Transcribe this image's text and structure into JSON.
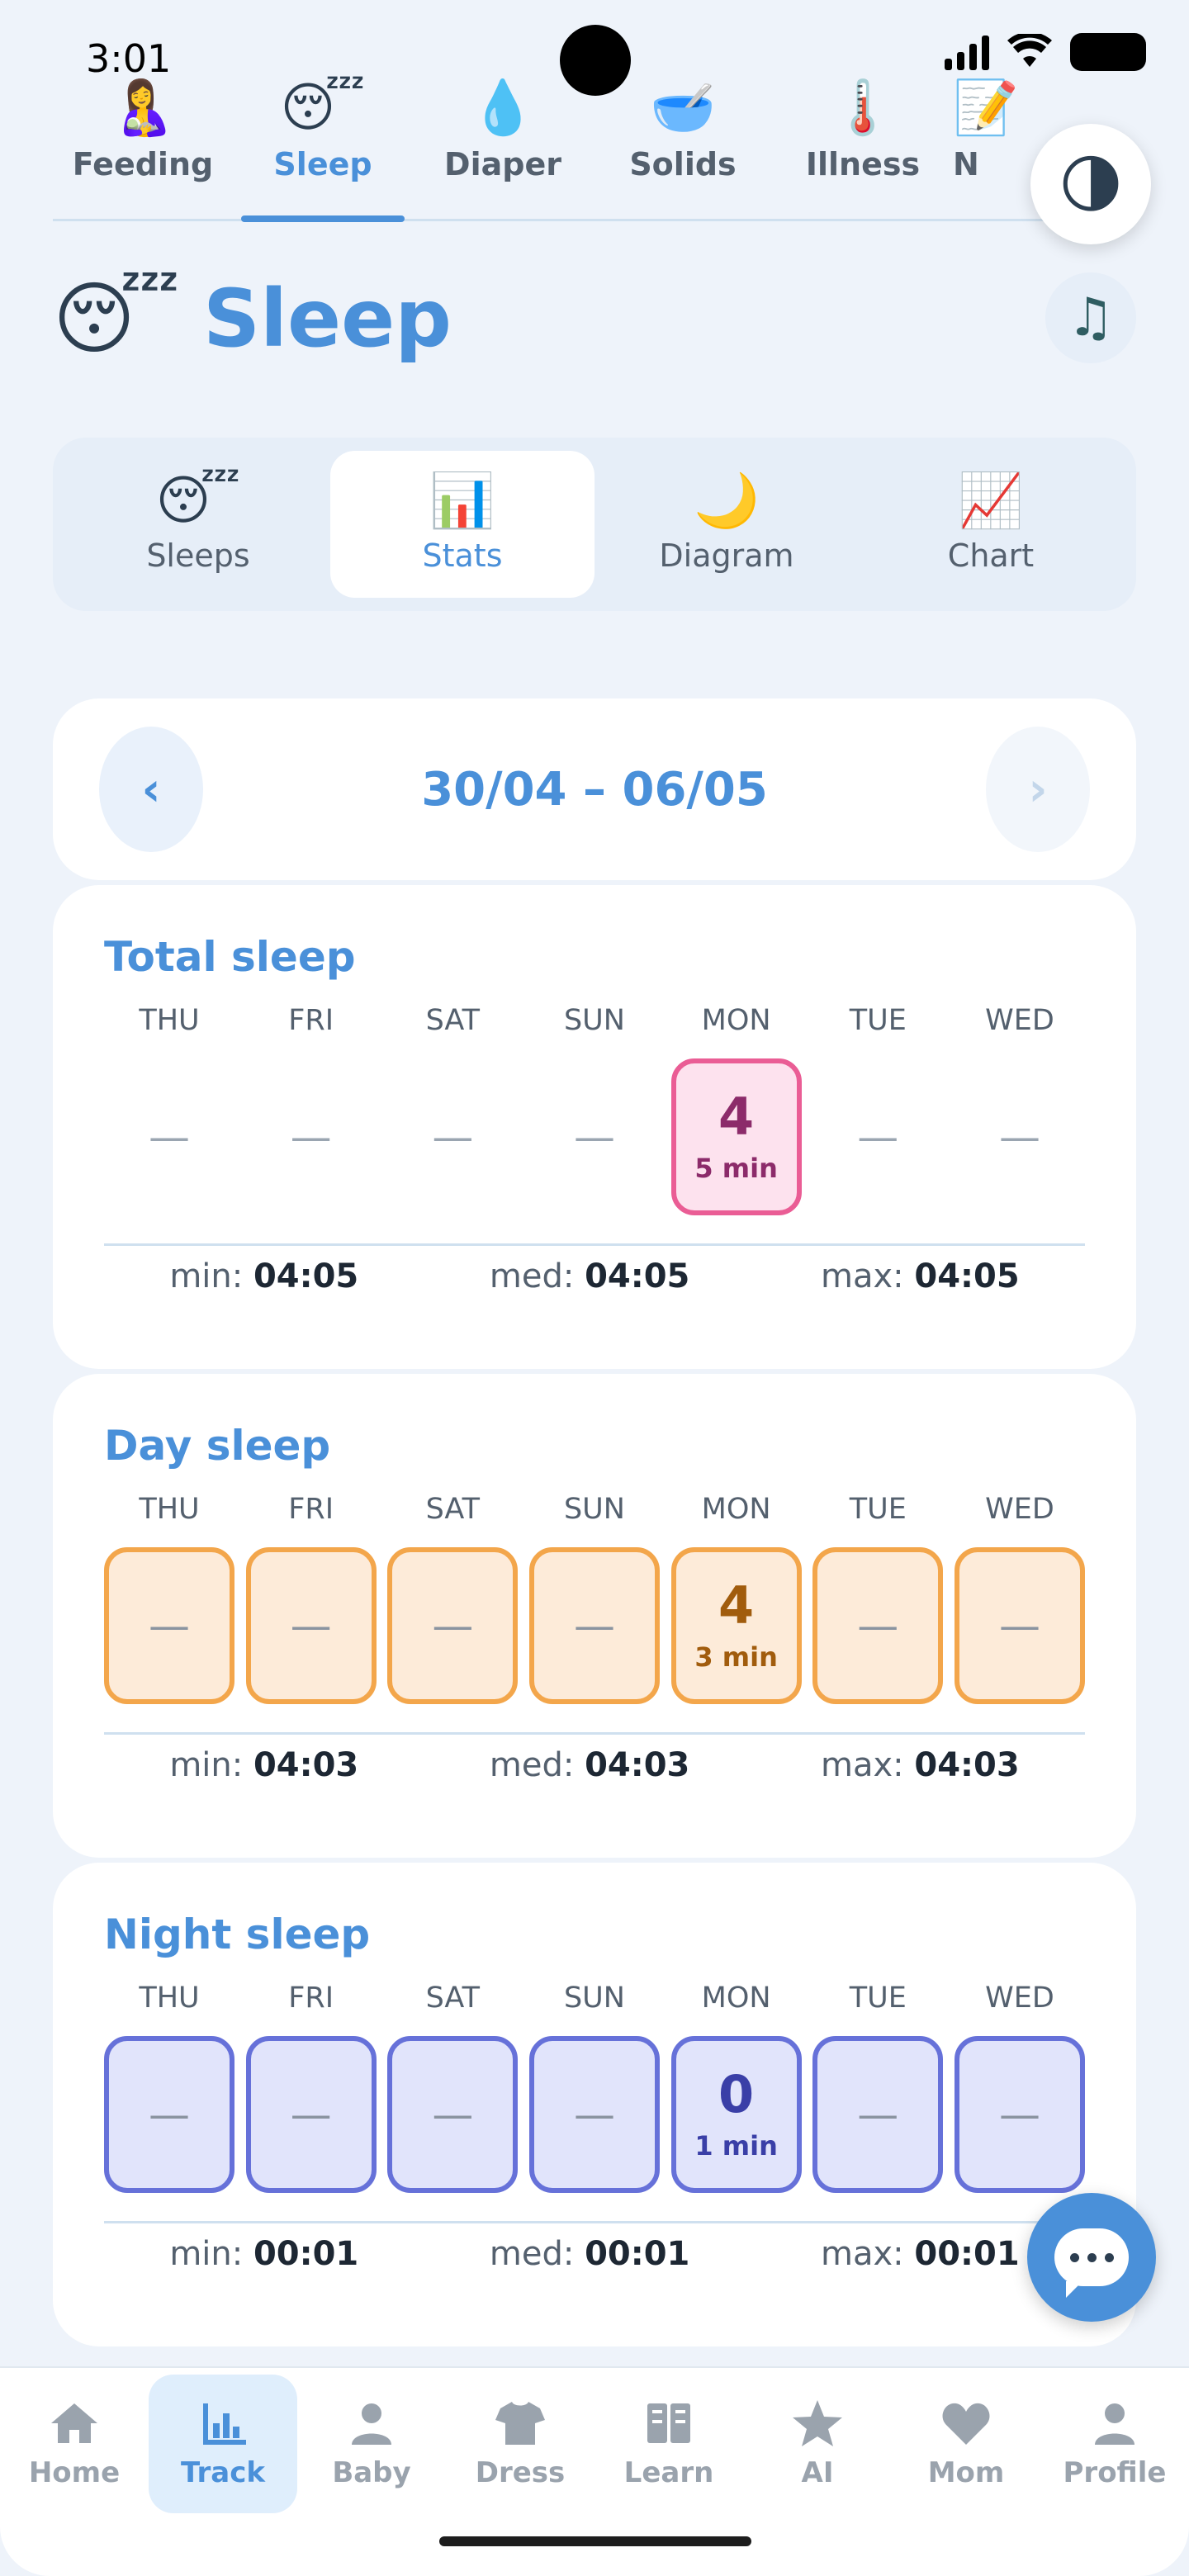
{
  "status_bar": {
    "time": "3:01"
  },
  "top_tabs": [
    {
      "emoji": "🤱",
      "label": "Feeding",
      "active": false
    },
    {
      "emoji": "😴",
      "label": "Sleep",
      "active": true
    },
    {
      "emoji": "💧",
      "label": "Diaper",
      "active": false
    },
    {
      "emoji": "🥣",
      "label": "Solids",
      "active": false
    },
    {
      "emoji": "🌡️",
      "label": "Illness",
      "active": false
    },
    {
      "emoji": "📝",
      "label": "N",
      "active": false
    }
  ],
  "theme_toggle": {
    "emoji": "🌗"
  },
  "page": {
    "title_emoji": "😴",
    "title": "Sleep",
    "music_icon": "♫"
  },
  "segments": [
    {
      "emoji": "😴",
      "label": "Sleeps",
      "active": false
    },
    {
      "emoji": "📊",
      "label": "Stats",
      "active": true
    },
    {
      "emoji": "🌙",
      "label": "Diagram",
      "active": false
    },
    {
      "emoji": "📈",
      "label": "Chart",
      "active": false
    }
  ],
  "week": {
    "range": "30/04 – 06/05",
    "prev": "‹",
    "next": "›"
  },
  "days": [
    "THU",
    "FRI",
    "SAT",
    "SUN",
    "MON",
    "TUE",
    "WED"
  ],
  "cards": [
    {
      "title": "Total sleep",
      "min_label": "min:",
      "min": "04:05",
      "med_label": "med:",
      "med": "04:05",
      "max_label": "max:",
      "max": "04:05",
      "cells": [
        {
          "main": "—",
          "sub": ""
        },
        {
          "main": "—",
          "sub": ""
        },
        {
          "main": "—",
          "sub": ""
        },
        {
          "main": "—",
          "sub": ""
        },
        {
          "main": "4",
          "sub": "5 min"
        },
        {
          "main": "—",
          "sub": ""
        },
        {
          "main": "—",
          "sub": ""
        }
      ]
    },
    {
      "title": "Day sleep",
      "min_label": "min:",
      "min": "04:03",
      "med_label": "med:",
      "med": "04:03",
      "max_label": "max:",
      "max": "04:03",
      "cells": [
        {
          "main": "—",
          "sub": ""
        },
        {
          "main": "—",
          "sub": ""
        },
        {
          "main": "—",
          "sub": ""
        },
        {
          "main": "—",
          "sub": ""
        },
        {
          "main": "4",
          "sub": "3 min"
        },
        {
          "main": "—",
          "sub": ""
        },
        {
          "main": "—",
          "sub": ""
        }
      ]
    },
    {
      "title": "Night sleep",
      "min_label": "min:",
      "min": "00:01",
      "med_label": "med:",
      "med": "00:01",
      "max_label": "max:",
      "max": "00:01",
      "cells": [
        {
          "main": "—",
          "sub": ""
        },
        {
          "main": "—",
          "sub": ""
        },
        {
          "main": "—",
          "sub": ""
        },
        {
          "main": "—",
          "sub": ""
        },
        {
          "main": "0",
          "sub": "1 min"
        },
        {
          "main": "—",
          "sub": ""
        },
        {
          "main": "—",
          "sub": ""
        }
      ]
    }
  ],
  "bottom_nav": [
    {
      "icon": "home-icon",
      "label": "Home",
      "active": false
    },
    {
      "icon": "chart-icon",
      "label": "Track",
      "active": true
    },
    {
      "icon": "person-icon",
      "label": "Baby",
      "active": false
    },
    {
      "icon": "shirt-icon",
      "label": "Dress",
      "active": false
    },
    {
      "icon": "book-icon",
      "label": "Learn",
      "active": false
    },
    {
      "icon": "star-icon",
      "label": "AI",
      "active": false
    },
    {
      "icon": "heart-icon",
      "label": "Mom",
      "active": false
    },
    {
      "icon": "profile-icon",
      "label": "Profile",
      "active": false
    }
  ],
  "colors": {
    "accent": "#4a90d9",
    "total_border": "#ea5d95",
    "day_border": "#f3a64b",
    "night_border": "#6671d9"
  }
}
